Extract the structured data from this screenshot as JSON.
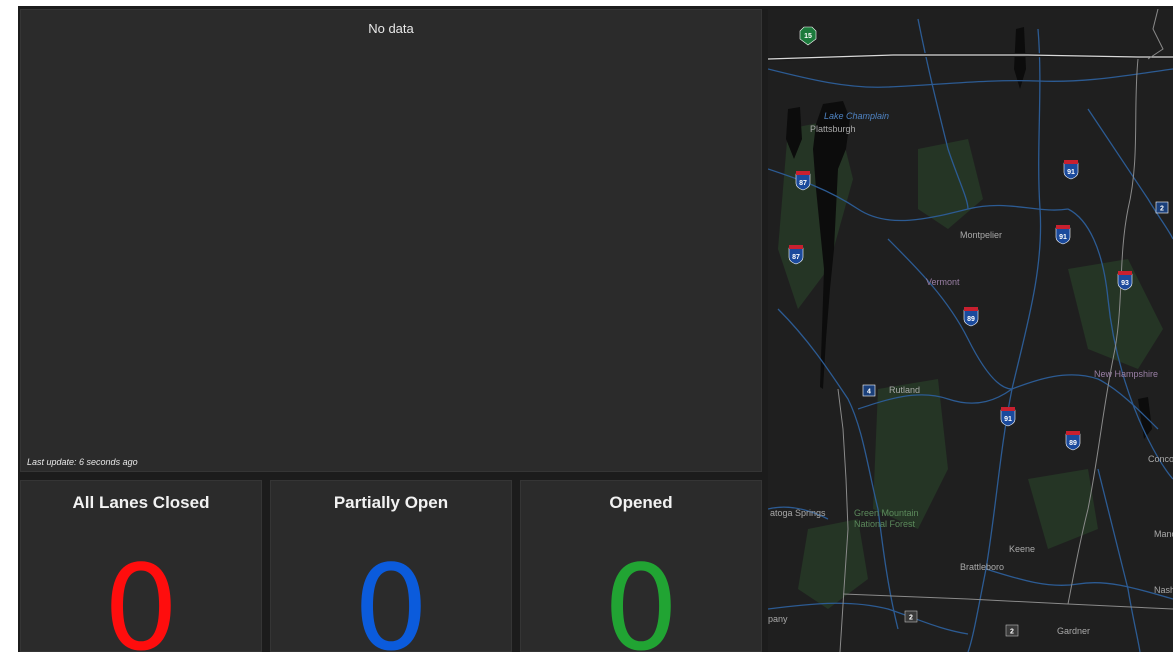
{
  "list_panel": {
    "no_data": "No data",
    "last_update": "Last update: 6 seconds ago"
  },
  "indicators": [
    {
      "title": "All Lanes Closed",
      "value": "0",
      "color": "#ff0d0d"
    },
    {
      "title": "Partially Open",
      "value": "0",
      "color": "#0b5bdc"
    },
    {
      "title": "Opened",
      "value": "0",
      "color": "#21a433"
    }
  ],
  "map": {
    "places": {
      "plattsburgh": "Plattsburgh",
      "montpelier": "Montpelier",
      "rutland": "Rutland",
      "keene": "Keene",
      "brattleboro": "Brattleboro",
      "gardner": "Gardner",
      "concord": "Concord",
      "manchester": "Manc",
      "nashua": "Nash",
      "saratoga": "atoga Springs",
      "albany": "pany"
    },
    "states": {
      "vermont": "Vermont",
      "new_hampshire": "New Hampshire"
    },
    "water": {
      "lake_champlain": "Lake Champlain"
    },
    "forest": {
      "line1": "Green Mountain",
      "line2": "National Forest"
    },
    "shields": {
      "i87a": "87",
      "i87b": "87",
      "i91a": "91",
      "i91b": "91",
      "i91c": "91",
      "i93": "93",
      "i89a": "89",
      "i89b": "89",
      "us4": "4",
      "us2a": "2",
      "us2b": "2",
      "us2c": "2",
      "ca15": "15"
    },
    "colors": {
      "land": "#1f1f1f",
      "water": "#0c0c0c",
      "river": "#2c5b93",
      "forest": "#253525",
      "border": "#bcbcbc"
    }
  }
}
